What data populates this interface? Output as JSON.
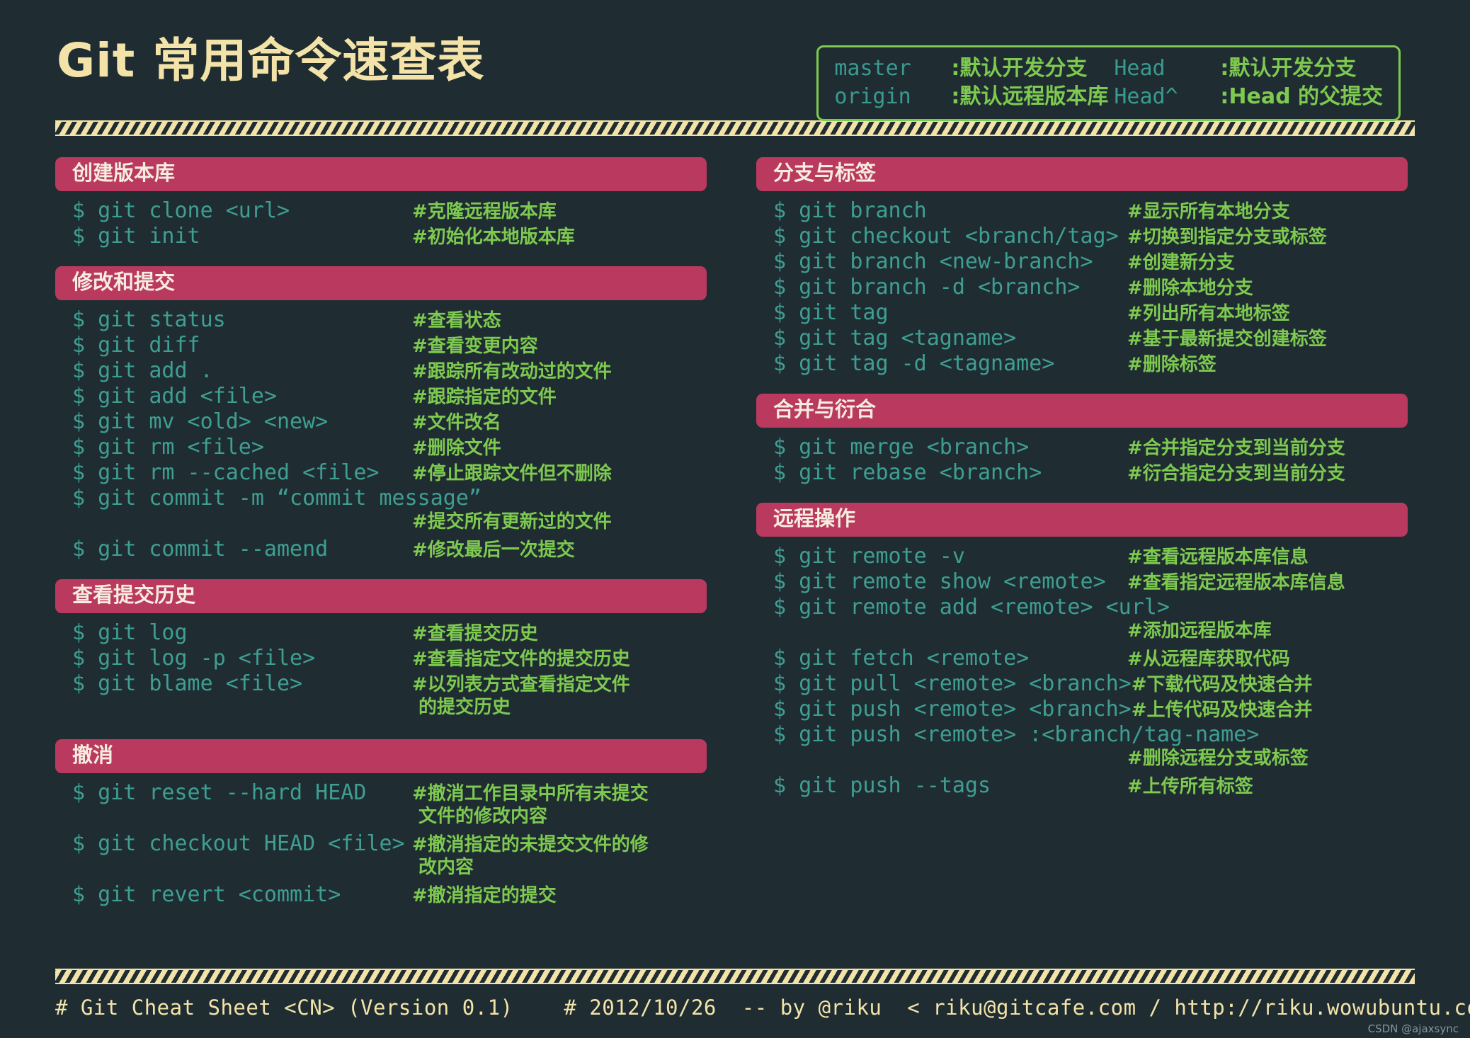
{
  "title": "Git 常用命令速查表",
  "legend": [
    [
      {
        "term": "master",
        "desc": ":默认开发分支"
      },
      {
        "term": "Head",
        "desc": ":默认开发分支"
      }
    ],
    [
      {
        "term": "origin",
        "desc": ":默认远程版本库"
      },
      {
        "term": "Head^",
        "desc": ":Head 的父提交"
      }
    ]
  ],
  "left_sections": [
    {
      "title": "创建版本库",
      "rows": [
        {
          "cmd": "$ git clone <url>",
          "note": "#克隆远程版本库"
        },
        {
          "cmd": "$ git init",
          "note": "#初始化本地版本库"
        }
      ]
    },
    {
      "title": "修改和提交",
      "rows": [
        {
          "cmd": "$ git status",
          "note": "#查看状态"
        },
        {
          "cmd": "$ git diff",
          "note": "#查看变更内容"
        },
        {
          "cmd": "$ git add .",
          "note": "#跟踪所有改动过的文件"
        },
        {
          "cmd": "$ git add <file>",
          "note": "#跟踪指定的文件"
        },
        {
          "cmd": "$ git mv <old> <new>",
          "note": "#文件改名"
        },
        {
          "cmd": "$ git rm <file>",
          "note": "#删除文件"
        },
        {
          "cmd": "$ git rm --cached <file>",
          "note": "#停止跟踪文件但不删除"
        },
        {
          "cmd": "$ git commit -m “commit message”",
          "note": ""
        },
        {
          "cmd": "",
          "note": "#提交所有更新过的文件",
          "wrap": true
        },
        {
          "cmd": "$ git commit --amend",
          "note": "#修改最后一次提交"
        }
      ]
    },
    {
      "title": "查看提交历史",
      "rows": [
        {
          "cmd": "$ git log",
          "note": "#查看提交历史"
        },
        {
          "cmd": "$ git log -p <file>",
          "note": "#查看指定文件的提交历史"
        },
        {
          "cmd": "$ git blame <file>",
          "note": "#以列表方式查看指定文件"
        },
        {
          "cmd": "",
          "note": " 的提交历史",
          "wrap": true
        }
      ]
    },
    {
      "title": "撤消",
      "rows": [
        {
          "cmd": "$ git reset --hard HEAD",
          "note": "#撤消工作目录中所有未提交"
        },
        {
          "cmd": "",
          "note": " 文件的修改内容",
          "wrap": true
        },
        {
          "cmd": "$ git checkout HEAD <file>",
          "note": "#撤消指定的未提交文件的修"
        },
        {
          "cmd": "",
          "note": " 改内容",
          "wrap": true
        },
        {
          "cmd": "$ git revert <commit>",
          "note": "#撤消指定的提交"
        }
      ]
    }
  ],
  "right_sections": [
    {
      "title": "分支与标签",
      "rows": [
        {
          "cmd": "$ git branch",
          "note": "#显示所有本地分支"
        },
        {
          "cmd": "$ git checkout <branch/tag>",
          "note": "#切换到指定分支或标签"
        },
        {
          "cmd": "$ git branch <new-branch>",
          "note": "#创建新分支"
        },
        {
          "cmd": "$ git branch -d <branch>",
          "note": "#删除本地分支"
        },
        {
          "cmd": "$ git tag",
          "note": "#列出所有本地标签"
        },
        {
          "cmd": "$ git tag <tagname>",
          "note": "#基于最新提交创建标签"
        },
        {
          "cmd": "$ git tag -d <tagname>",
          "note": "#删除标签"
        }
      ]
    },
    {
      "title": "合并与衍合",
      "rows": [
        {
          "cmd": "$ git merge <branch>",
          "note": "#合并指定分支到当前分支"
        },
        {
          "cmd": "$ git rebase <branch>",
          "note": "#衍合指定分支到当前分支"
        }
      ]
    },
    {
      "title": "远程操作",
      "rows": [
        {
          "cmd": "$ git remote -v",
          "note": "#查看远程版本库信息"
        },
        {
          "cmd": "$ git remote show <remote>",
          "note": "#查看指定远程版本库信息"
        },
        {
          "cmd": "$ git remote add <remote> <url>",
          "note": ""
        },
        {
          "cmd": "",
          "note": "#添加远程版本库",
          "wrap": true
        },
        {
          "cmd": "$ git fetch <remote>",
          "note": "#从远程库获取代码"
        },
        {
          "cmd": "$ git pull <remote> <branch>",
          "note": "#下载代码及快速合并"
        },
        {
          "cmd": "$ git push <remote> <branch>",
          "note": "#上传代码及快速合并"
        },
        {
          "cmd": "$ git push <remote> :<branch/tag-name>",
          "note": ""
        },
        {
          "cmd": "",
          "note": "#删除远程分支或标签",
          "wrap": true
        },
        {
          "cmd": "$ git push --tags",
          "note": "#上传所有标签"
        }
      ]
    }
  ],
  "footer": "# Git Cheat Sheet <CN> (Version 0.1)    # 2012/10/26  -- by @riku  < riku@gitcafe.com / http://riku.wowubuntu.com >",
  "watermark": "CSDN @ajaxsync",
  "colors": {
    "background": "#1f2d33",
    "title": "#f3e3a8",
    "command": "#3f9e92",
    "note": "#7ec94f",
    "section_bar": "#b93a5e",
    "section_text": "#f7ece0",
    "legend_border": "#7ec94f",
    "legend_term": "#3a9a90"
  }
}
